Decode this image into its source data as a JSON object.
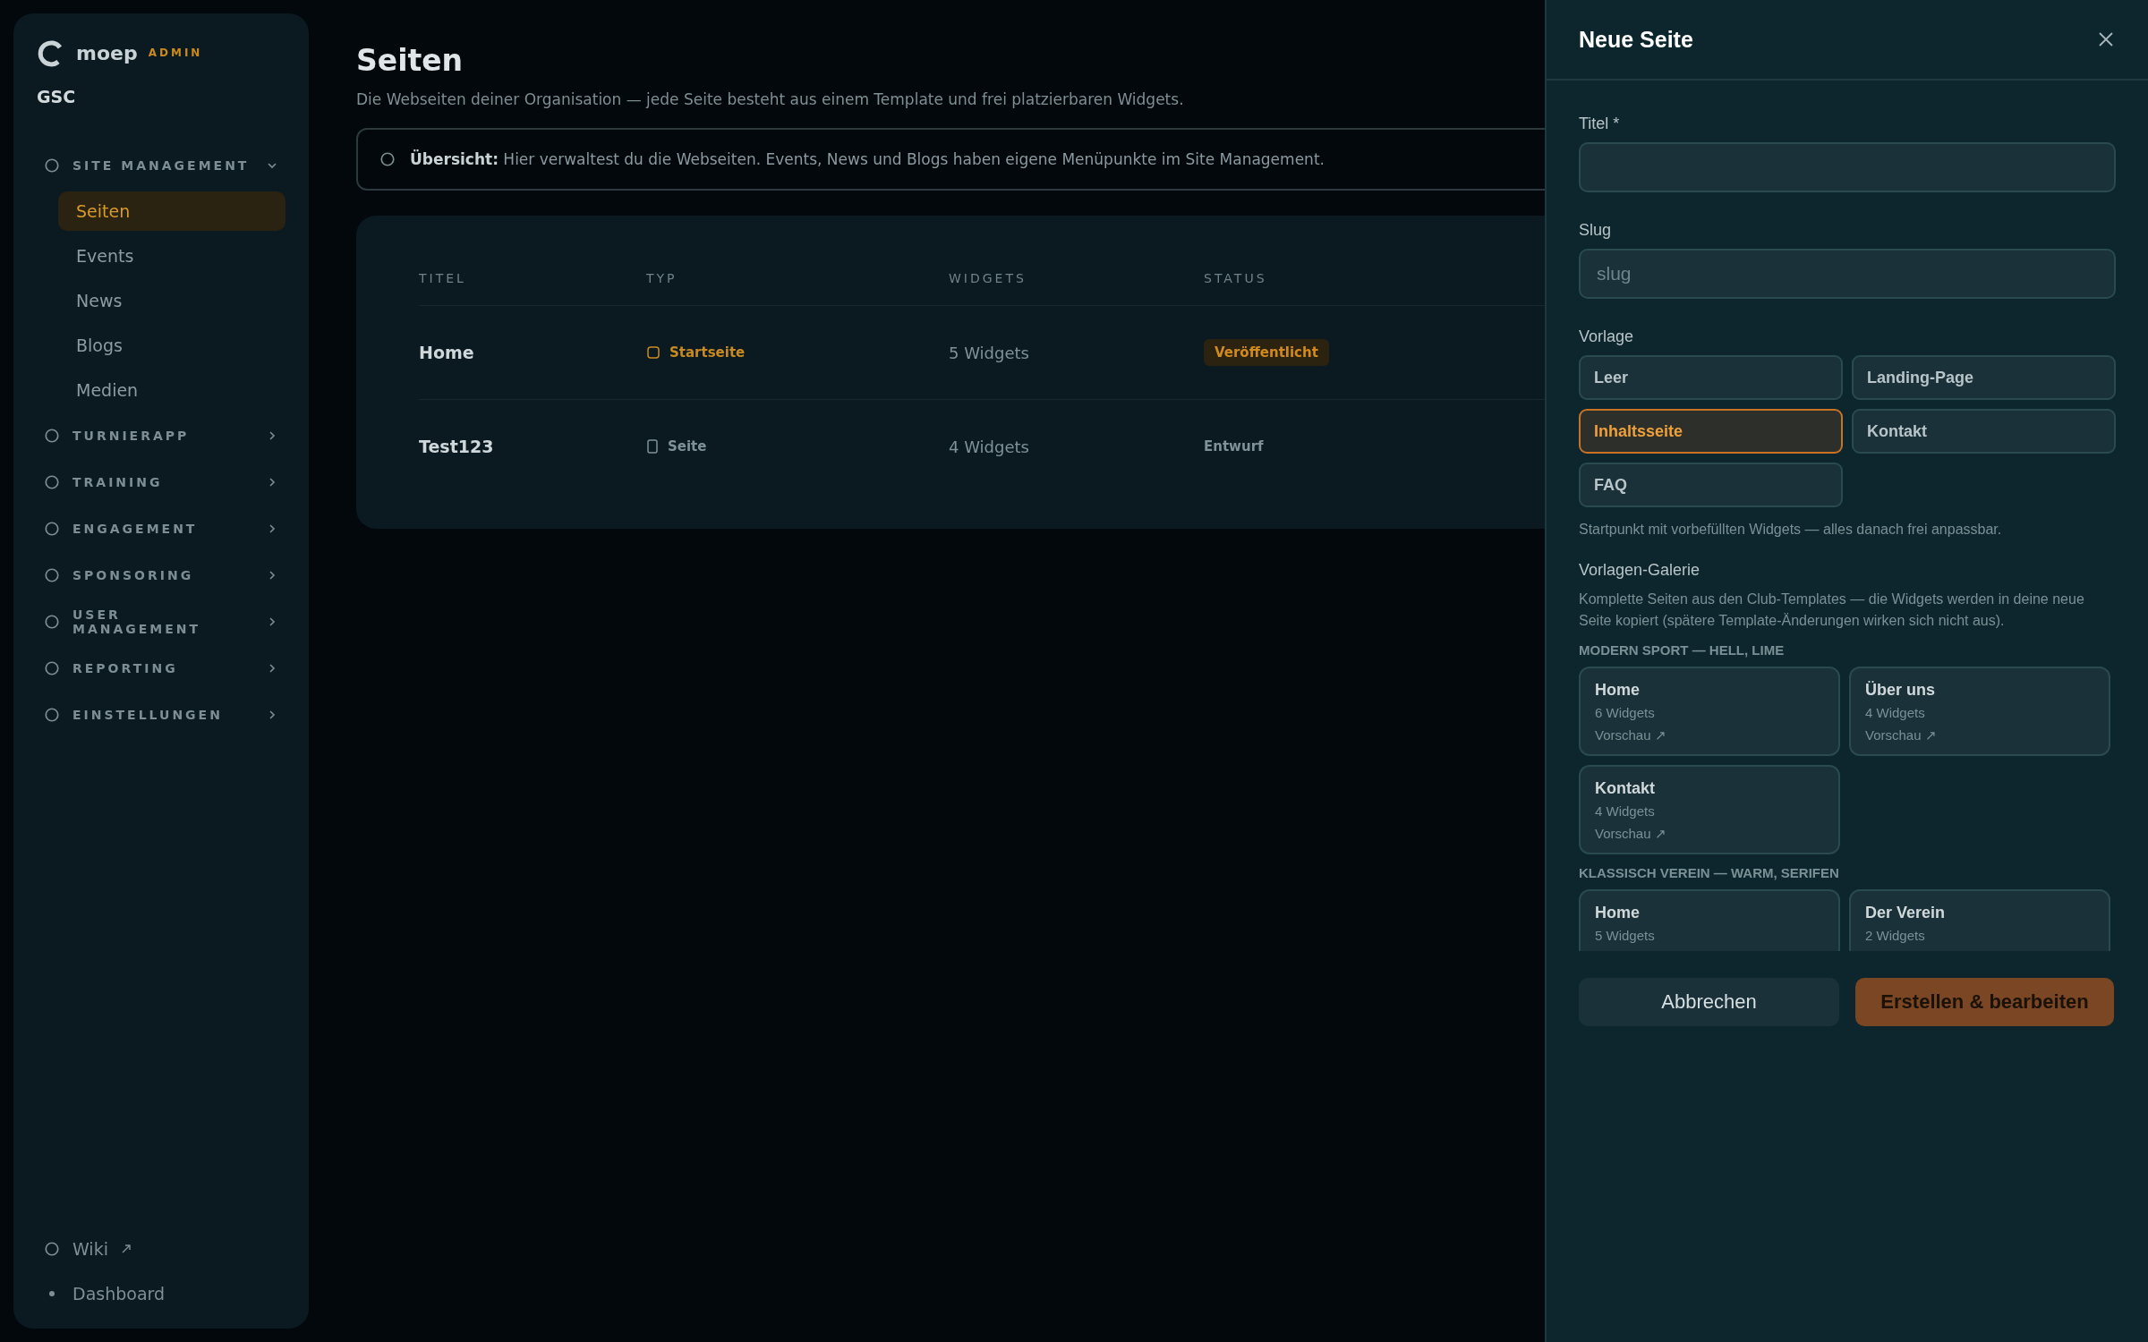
{
  "sidebar": {
    "brand": "moep",
    "brand_badge": "ADMIN",
    "org": "GSC",
    "sections": [
      {
        "label": "SITE MANAGEMENT",
        "expanded": true,
        "children": [
          {
            "label": "Seiten",
            "selected": true
          },
          {
            "label": "Events",
            "selected": false
          },
          {
            "label": "News",
            "selected": false
          },
          {
            "label": "Blogs",
            "selected": false
          },
          {
            "label": "Medien",
            "selected": false
          }
        ]
      },
      {
        "label": "TURNIERAPP",
        "expanded": false
      },
      {
        "label": "TRAINING",
        "expanded": false
      },
      {
        "label": "ENGAGEMENT",
        "expanded": false
      },
      {
        "label": "SPONSORING",
        "expanded": false
      },
      {
        "label": "USER MANAGEMENT",
        "expanded": false
      },
      {
        "label": "REPORTING",
        "expanded": false
      },
      {
        "label": "EINSTELLUNGEN",
        "expanded": false
      }
    ],
    "footer": [
      {
        "label": "Wiki",
        "kind": "external"
      },
      {
        "label": "Dashboard",
        "kind": "back"
      }
    ]
  },
  "page": {
    "title": "Seiten",
    "subtitle": "Die Webseiten deiner Organisation — jede Seite besteht aus einem Template und frei platzierbaren Widgets.",
    "notice": {
      "title": "Übersicht:",
      "text": "Hier verwaltest du die Webseiten. Events, News und Blogs haben eigene Menüpunkte im Site Management."
    },
    "table": {
      "columns": [
        "TITEL",
        "TYP",
        "WIDGETS",
        "STATUS"
      ],
      "rows": [
        {
          "title": "Home",
          "type": "Startseite",
          "widgets": "5 Widgets",
          "status": "Veröffentlicht",
          "highlighted": true
        },
        {
          "title": "Test123",
          "type": "Seite",
          "widgets": "4 Widgets",
          "status": "Entwurf",
          "highlighted": false
        }
      ]
    }
  },
  "drawer": {
    "title": "Neue Seite",
    "fields": [
      {
        "label": "Titel *"
      },
      {
        "label": "Slug",
        "placeholder": "slug"
      }
    ],
    "template_label": "Vorlage",
    "templates": [
      {
        "label": "Leer",
        "selected": false
      },
      {
        "label": "Landing-Page",
        "selected": false
      },
      {
        "label": "Inhaltsseite",
        "selected": true
      },
      {
        "label": "Kontakt",
        "selected": false
      },
      {
        "label": "FAQ",
        "selected": false
      }
    ],
    "template_hint": "Startpunkt mit vorbefüllten Widgets — alles danach frei anpassbar.",
    "gallery": {
      "title": "Vorlagen-Galerie",
      "description": "Komplette Seiten aus den Club-Templates — die Widgets werden in deine neue Seite kopiert (spätere Template-Änderungen wirken sich nicht aus).",
      "groups": [
        {
          "title": "MODERN SPORT — HELL, LIME",
          "cards": [
            {
              "title": "Home",
              "count": "6 Widgets",
              "link": "Vorschau ↗"
            },
            {
              "title": "Über uns",
              "count": "4 Widgets",
              "link": "Vorschau ↗"
            },
            {
              "title": "Kontakt",
              "count": "4 Widgets",
              "link": "Vorschau ↗"
            }
          ]
        },
        {
          "title": "KLASSISCH VEREIN — WARM, SERIFEN",
          "cards": [
            {
              "title": "Home",
              "count": "5 Widgets"
            },
            {
              "title": "Der Verein",
              "count": "2 Widgets"
            }
          ]
        }
      ]
    },
    "buttons": [
      {
        "label": "Abbrechen",
        "kind": "secondary"
      },
      {
        "label": "Erstellen & bearbeiten",
        "kind": "primary"
      }
    ]
  }
}
